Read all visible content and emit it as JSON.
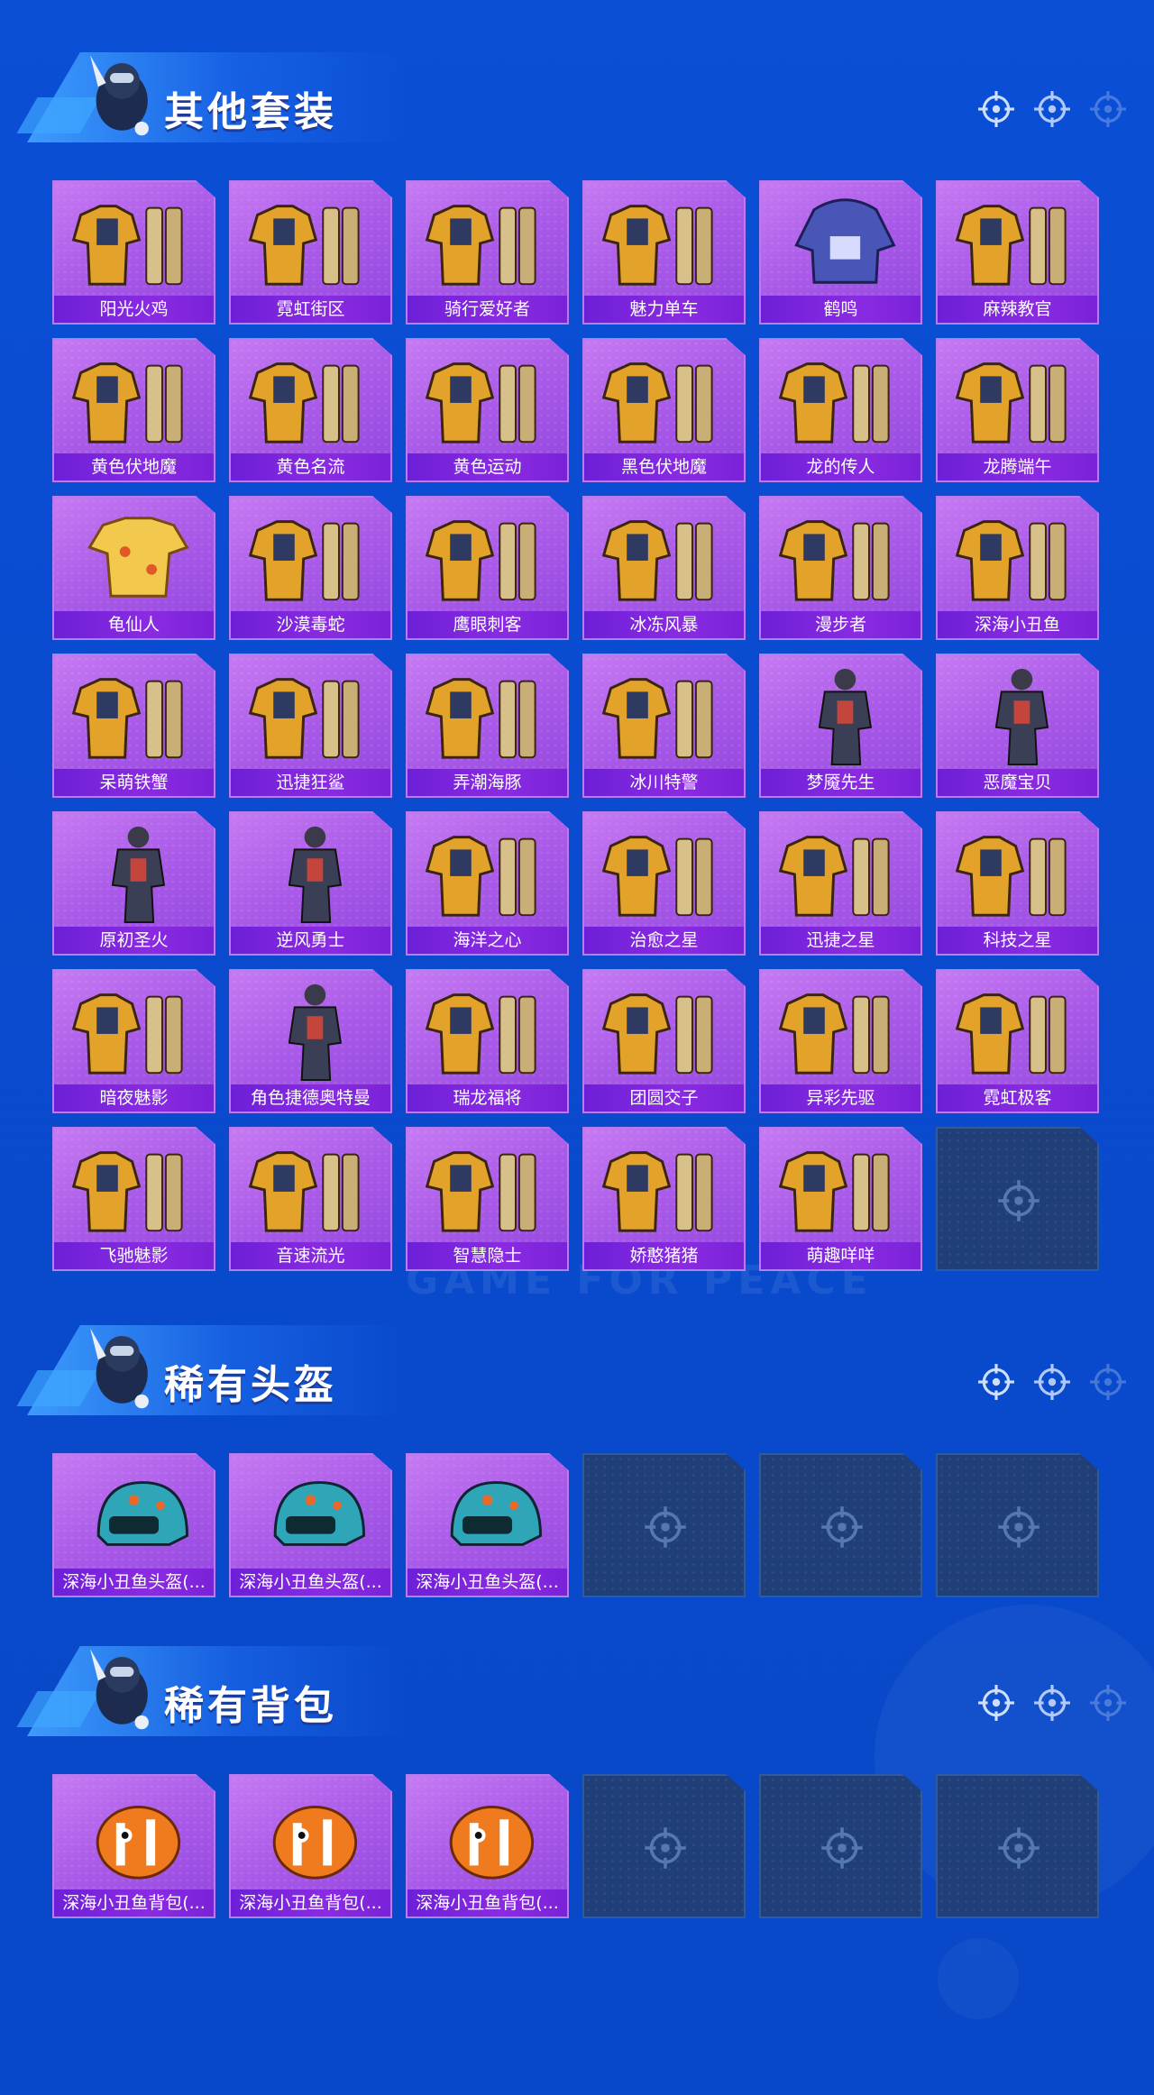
{
  "background": {
    "watermark": "GAME FOR PEACE"
  },
  "colors": {
    "card_purple": "#a95ae8",
    "label_purple": "#7a22d8",
    "empty_slot": "#203f78",
    "page_blue": "#0a4bcf"
  },
  "sections": [
    {
      "title": "其他套装",
      "items": [
        {
          "label": "阳光火鸡",
          "icon": "outfit-icon"
        },
        {
          "label": "霓虹街区",
          "icon": "outfit-icon"
        },
        {
          "label": "骑行爱好者",
          "icon": "outfit-icon"
        },
        {
          "label": "魅力单车",
          "icon": "outfit-icon"
        },
        {
          "label": "鹤鸣",
          "icon": "hoodie-icon"
        },
        {
          "label": "麻辣教官",
          "icon": "outfit-icon"
        },
        {
          "label": "黄色伏地魔",
          "icon": "outfit-icon"
        },
        {
          "label": "黄色名流",
          "icon": "outfit-icon"
        },
        {
          "label": "黄色运动",
          "icon": "outfit-icon"
        },
        {
          "label": "黑色伏地魔",
          "icon": "outfit-icon"
        },
        {
          "label": "龙的传人",
          "icon": "outfit-icon"
        },
        {
          "label": "龙腾端午",
          "icon": "outfit-icon"
        },
        {
          "label": "龟仙人",
          "icon": "shirt-icon"
        },
        {
          "label": "沙漠毒蛇",
          "icon": "outfit-icon"
        },
        {
          "label": "鹰眼刺客",
          "icon": "outfit-icon"
        },
        {
          "label": "冰冻风暴",
          "icon": "outfit-icon"
        },
        {
          "label": "漫步者",
          "icon": "outfit-icon"
        },
        {
          "label": "深海小丑鱼",
          "icon": "outfit-icon"
        },
        {
          "label": "呆萌铁蟹",
          "icon": "outfit-icon"
        },
        {
          "label": "迅捷狂鲨",
          "icon": "outfit-icon"
        },
        {
          "label": "弄潮海豚",
          "icon": "outfit-icon"
        },
        {
          "label": "冰川特警",
          "icon": "outfit-icon"
        },
        {
          "label": "梦魇先生",
          "icon": "character-icon"
        },
        {
          "label": "恶魔宝贝",
          "icon": "character-icon"
        },
        {
          "label": "原初圣火",
          "icon": "character-icon"
        },
        {
          "label": "逆风勇士",
          "icon": "character-icon"
        },
        {
          "label": "海洋之心",
          "icon": "outfit-icon"
        },
        {
          "label": "治愈之星",
          "icon": "outfit-icon"
        },
        {
          "label": "迅捷之星",
          "icon": "outfit-icon"
        },
        {
          "label": "科技之星",
          "icon": "outfit-icon"
        },
        {
          "label": "暗夜魅影",
          "icon": "outfit-icon"
        },
        {
          "label": "角色捷德奥特曼",
          "icon": "character-icon"
        },
        {
          "label": "瑞龙福将",
          "icon": "outfit-icon"
        },
        {
          "label": "团圆交子",
          "icon": "outfit-icon"
        },
        {
          "label": "异彩先驱",
          "icon": "outfit-icon"
        },
        {
          "label": "霓虹极客",
          "icon": "outfit-icon"
        },
        {
          "label": "飞驰魅影",
          "icon": "outfit-icon"
        },
        {
          "label": "音速流光",
          "icon": "outfit-icon"
        },
        {
          "label": "智慧隐士",
          "icon": "outfit-icon"
        },
        {
          "label": "娇憨猪猪",
          "icon": "outfit-icon"
        },
        {
          "label": "萌趣咩咩",
          "icon": "outfit-icon"
        }
      ],
      "empty_slots": 1
    },
    {
      "title": "稀有头盔",
      "items": [
        {
          "label": "深海小丑鱼头盔(...",
          "icon": "helmet-icon"
        },
        {
          "label": "深海小丑鱼头盔(...",
          "icon": "helmet-icon"
        },
        {
          "label": "深海小丑鱼头盔(...",
          "icon": "helmet-icon"
        }
      ],
      "empty_slots": 3
    },
    {
      "title": "稀有背包",
      "items": [
        {
          "label": "深海小丑鱼背包(...",
          "icon": "backpack-icon"
        },
        {
          "label": "深海小丑鱼背包(...",
          "icon": "backpack-icon"
        },
        {
          "label": "深海小丑鱼背包(...",
          "icon": "backpack-icon"
        }
      ],
      "empty_slots": 3
    }
  ]
}
